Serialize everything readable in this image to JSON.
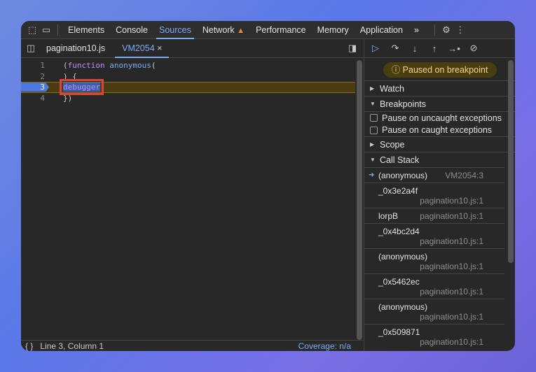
{
  "toolbar": {
    "tabs": [
      "Elements",
      "Console",
      "Sources",
      "Network",
      "Performance",
      "Memory",
      "Application"
    ],
    "active": "Sources",
    "more": "»"
  },
  "files": {
    "tabs": [
      "pagination10.js",
      "VM2054"
    ],
    "close": "×"
  },
  "code": {
    "lines": [
      {
        "n": "1",
        "text": "(function anonymous("
      },
      {
        "n": "2",
        "text": ") {"
      },
      {
        "n": "3",
        "text": "debugger"
      },
      {
        "n": "4",
        "text": "})"
      }
    ]
  },
  "status": {
    "position": "Line 3, Column 1",
    "coverage": "Coverage: n/a",
    "braces": "{ }"
  },
  "debugger": {
    "paused": "Paused on breakpoint",
    "watch": "Watch",
    "breakpoints": "Breakpoints",
    "uncaught": "Pause on uncaught exceptions",
    "caught": "Pause on caught exceptions",
    "scope": "Scope",
    "callstack": "Call Stack",
    "frames": [
      {
        "name": "(anonymous)",
        "loc": "VM2054:3"
      },
      {
        "name": "_0x3e2a4f",
        "loc": "pagination10.js:1"
      },
      {
        "name": "lorpB",
        "loc": "pagination10.js:1"
      },
      {
        "name": "_0x4bc2d4",
        "loc": "pagination10.js:1"
      },
      {
        "name": "(anonymous)",
        "loc": "pagination10.js:1"
      },
      {
        "name": "_0x5462ec",
        "loc": "pagination10.js:1"
      },
      {
        "name": "(anonymous)",
        "loc": "pagination10.js:1"
      },
      {
        "name": "_0x509871",
        "loc": "pagination10.js:1"
      }
    ]
  }
}
